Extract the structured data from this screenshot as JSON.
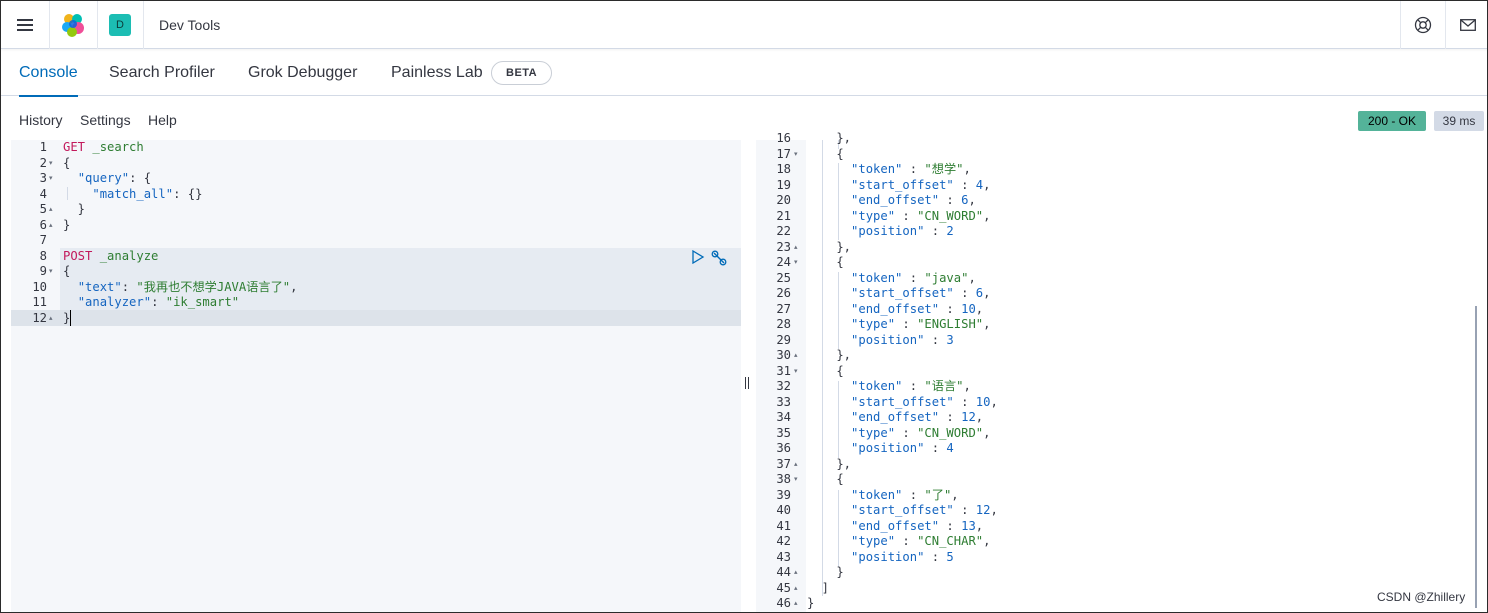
{
  "app": {
    "title": "Dev Tools",
    "space_initial": "D"
  },
  "tabs": [
    {
      "label": "Console",
      "active": true
    },
    {
      "label": "Search Profiler",
      "active": false
    },
    {
      "label": "Grok Debugger",
      "active": false
    },
    {
      "label": "Painless Lab",
      "active": false
    }
  ],
  "beta_badge": "BETA",
  "toolbar": {
    "history": "History",
    "settings": "Settings",
    "help": "Help"
  },
  "response_status": {
    "status": "200 - OK",
    "time": "39 ms",
    "status_color": "#54b399"
  },
  "header_icons": [
    "menu-icon",
    "elastic-logo",
    "help-icon",
    "mail-icon"
  ],
  "request_lines": [
    {
      "num": "1",
      "fold": "",
      "tokens": [
        [
          "GET",
          "method"
        ],
        [
          " _search",
          "path"
        ]
      ]
    },
    {
      "num": "2",
      "fold": "▾",
      "tokens": [
        [
          "{",
          "punc"
        ]
      ]
    },
    {
      "num": "3",
      "fold": "▾",
      "tokens": [
        [
          "  ",
          "punc"
        ],
        [
          "\"query\"",
          "key"
        ],
        [
          ": {",
          "punc"
        ]
      ]
    },
    {
      "num": "4",
      "fold": "",
      "tokens": [
        [
          "    ",
          "punc"
        ],
        [
          "\"match_all\"",
          "key"
        ],
        [
          ": {}",
          "punc"
        ]
      ]
    },
    {
      "num": "5",
      "fold": "▴",
      "tokens": [
        [
          "  }",
          "punc"
        ]
      ]
    },
    {
      "num": "6",
      "fold": "▴",
      "tokens": [
        [
          "}",
          "punc"
        ]
      ]
    },
    {
      "num": "7",
      "fold": "",
      "tokens": []
    },
    {
      "num": "8",
      "fold": "",
      "tokens": [
        [
          "POST",
          "method"
        ],
        [
          " _analyze",
          "path"
        ]
      ]
    },
    {
      "num": "9",
      "fold": "▾",
      "tokens": [
        [
          "{",
          "punc"
        ]
      ]
    },
    {
      "num": "10",
      "fold": "",
      "tokens": [
        [
          "  ",
          "punc"
        ],
        [
          "\"text\"",
          "key"
        ],
        [
          ": ",
          "punc"
        ],
        [
          "\"我再也不想学JAVA语言了\"",
          "str"
        ],
        [
          ",",
          "punc"
        ]
      ]
    },
    {
      "num": "11",
      "fold": "",
      "tokens": [
        [
          "  ",
          "punc"
        ],
        [
          "\"analyzer\"",
          "key"
        ],
        [
          ": ",
          "punc"
        ],
        [
          "\"ik_smart\"",
          "str"
        ]
      ]
    },
    {
      "num": "12",
      "fold": "▴",
      "tokens": [
        [
          "}",
          "punc"
        ]
      ]
    }
  ],
  "response_lines": [
    {
      "num": "16",
      "fold": "",
      "tokens": [
        [
          "    },",
          "punc"
        ]
      ]
    },
    {
      "num": "17",
      "fold": "▾",
      "tokens": [
        [
          "    {",
          "punc"
        ]
      ]
    },
    {
      "num": "18",
      "fold": "",
      "tokens": [
        [
          "      ",
          "punc"
        ],
        [
          "\"token\"",
          "rkey"
        ],
        [
          " : ",
          "punc"
        ],
        [
          "\"想学\"",
          "str"
        ],
        [
          ",",
          "punc"
        ]
      ]
    },
    {
      "num": "19",
      "fold": "",
      "tokens": [
        [
          "      ",
          "punc"
        ],
        [
          "\"start_offset\"",
          "rkey"
        ],
        [
          " : ",
          "punc"
        ],
        [
          "4",
          "num"
        ],
        [
          ",",
          "punc"
        ]
      ]
    },
    {
      "num": "20",
      "fold": "",
      "tokens": [
        [
          "      ",
          "punc"
        ],
        [
          "\"end_offset\"",
          "rkey"
        ],
        [
          " : ",
          "punc"
        ],
        [
          "6",
          "num"
        ],
        [
          ",",
          "punc"
        ]
      ]
    },
    {
      "num": "21",
      "fold": "",
      "tokens": [
        [
          "      ",
          "punc"
        ],
        [
          "\"type\"",
          "rkey"
        ],
        [
          " : ",
          "punc"
        ],
        [
          "\"CN_WORD\"",
          "str"
        ],
        [
          ",",
          "punc"
        ]
      ]
    },
    {
      "num": "22",
      "fold": "",
      "tokens": [
        [
          "      ",
          "punc"
        ],
        [
          "\"position\"",
          "rkey"
        ],
        [
          " : ",
          "punc"
        ],
        [
          "2",
          "num"
        ]
      ]
    },
    {
      "num": "23",
      "fold": "▴",
      "tokens": [
        [
          "    },",
          "punc"
        ]
      ]
    },
    {
      "num": "24",
      "fold": "▾",
      "tokens": [
        [
          "    {",
          "punc"
        ]
      ]
    },
    {
      "num": "25",
      "fold": "",
      "tokens": [
        [
          "      ",
          "punc"
        ],
        [
          "\"token\"",
          "rkey"
        ],
        [
          " : ",
          "punc"
        ],
        [
          "\"java\"",
          "str"
        ],
        [
          ",",
          "punc"
        ]
      ]
    },
    {
      "num": "26",
      "fold": "",
      "tokens": [
        [
          "      ",
          "punc"
        ],
        [
          "\"start_offset\"",
          "rkey"
        ],
        [
          " : ",
          "punc"
        ],
        [
          "6",
          "num"
        ],
        [
          ",",
          "punc"
        ]
      ]
    },
    {
      "num": "27",
      "fold": "",
      "tokens": [
        [
          "      ",
          "punc"
        ],
        [
          "\"end_offset\"",
          "rkey"
        ],
        [
          " : ",
          "punc"
        ],
        [
          "10",
          "num"
        ],
        [
          ",",
          "punc"
        ]
      ]
    },
    {
      "num": "28",
      "fold": "",
      "tokens": [
        [
          "      ",
          "punc"
        ],
        [
          "\"type\"",
          "rkey"
        ],
        [
          " : ",
          "punc"
        ],
        [
          "\"ENGLISH\"",
          "str"
        ],
        [
          ",",
          "punc"
        ]
      ]
    },
    {
      "num": "29",
      "fold": "",
      "tokens": [
        [
          "      ",
          "punc"
        ],
        [
          "\"position\"",
          "rkey"
        ],
        [
          " : ",
          "punc"
        ],
        [
          "3",
          "num"
        ]
      ]
    },
    {
      "num": "30",
      "fold": "▴",
      "tokens": [
        [
          "    },",
          "punc"
        ]
      ]
    },
    {
      "num": "31",
      "fold": "▾",
      "tokens": [
        [
          "    {",
          "punc"
        ]
      ]
    },
    {
      "num": "32",
      "fold": "",
      "tokens": [
        [
          "      ",
          "punc"
        ],
        [
          "\"token\"",
          "rkey"
        ],
        [
          " : ",
          "punc"
        ],
        [
          "\"语言\"",
          "str"
        ],
        [
          ",",
          "punc"
        ]
      ]
    },
    {
      "num": "33",
      "fold": "",
      "tokens": [
        [
          "      ",
          "punc"
        ],
        [
          "\"start_offset\"",
          "rkey"
        ],
        [
          " : ",
          "punc"
        ],
        [
          "10",
          "num"
        ],
        [
          ",",
          "punc"
        ]
      ]
    },
    {
      "num": "34",
      "fold": "",
      "tokens": [
        [
          "      ",
          "punc"
        ],
        [
          "\"end_offset\"",
          "rkey"
        ],
        [
          " : ",
          "punc"
        ],
        [
          "12",
          "num"
        ],
        [
          ",",
          "punc"
        ]
      ]
    },
    {
      "num": "35",
      "fold": "",
      "tokens": [
        [
          "      ",
          "punc"
        ],
        [
          "\"type\"",
          "rkey"
        ],
        [
          " : ",
          "punc"
        ],
        [
          "\"CN_WORD\"",
          "str"
        ],
        [
          ",",
          "punc"
        ]
      ]
    },
    {
      "num": "36",
      "fold": "",
      "tokens": [
        [
          "      ",
          "punc"
        ],
        [
          "\"position\"",
          "rkey"
        ],
        [
          " : ",
          "punc"
        ],
        [
          "4",
          "num"
        ]
      ]
    },
    {
      "num": "37",
      "fold": "▴",
      "tokens": [
        [
          "    },",
          "punc"
        ]
      ]
    },
    {
      "num": "38",
      "fold": "▾",
      "tokens": [
        [
          "    {",
          "punc"
        ]
      ]
    },
    {
      "num": "39",
      "fold": "",
      "tokens": [
        [
          "      ",
          "punc"
        ],
        [
          "\"token\"",
          "rkey"
        ],
        [
          " : ",
          "punc"
        ],
        [
          "\"了\"",
          "str"
        ],
        [
          ",",
          "punc"
        ]
      ]
    },
    {
      "num": "40",
      "fold": "",
      "tokens": [
        [
          "      ",
          "punc"
        ],
        [
          "\"start_offset\"",
          "rkey"
        ],
        [
          " : ",
          "punc"
        ],
        [
          "12",
          "num"
        ],
        [
          ",",
          "punc"
        ]
      ]
    },
    {
      "num": "41",
      "fold": "",
      "tokens": [
        [
          "      ",
          "punc"
        ],
        [
          "\"end_offset\"",
          "rkey"
        ],
        [
          " : ",
          "punc"
        ],
        [
          "13",
          "num"
        ],
        [
          ",",
          "punc"
        ]
      ]
    },
    {
      "num": "42",
      "fold": "",
      "tokens": [
        [
          "      ",
          "punc"
        ],
        [
          "\"type\"",
          "rkey"
        ],
        [
          " : ",
          "punc"
        ],
        [
          "\"CN_CHAR\"",
          "str"
        ],
        [
          ",",
          "punc"
        ]
      ]
    },
    {
      "num": "43",
      "fold": "",
      "tokens": [
        [
          "      ",
          "punc"
        ],
        [
          "\"position\"",
          "rkey"
        ],
        [
          " : ",
          "punc"
        ],
        [
          "5",
          "num"
        ]
      ]
    },
    {
      "num": "44",
      "fold": "▴",
      "tokens": [
        [
          "    }",
          "punc"
        ]
      ]
    },
    {
      "num": "45",
      "fold": "▴",
      "tokens": [
        [
          "  ]",
          "punc"
        ]
      ]
    },
    {
      "num": "46",
      "fold": "▴",
      "tokens": [
        [
          "}",
          "punc"
        ]
      ]
    }
  ],
  "watermark": "CSDN @Zhillery"
}
